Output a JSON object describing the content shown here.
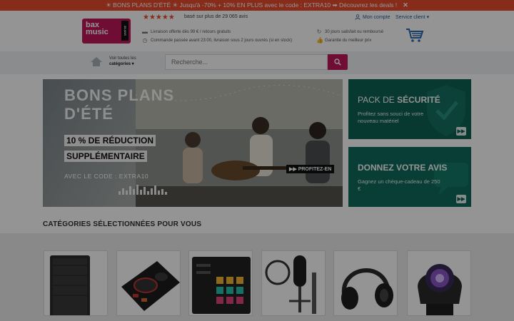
{
  "promo_banner": {
    "text": "☀ BONS PLANS D'ÉTÉ ☀ Jusqu'à -70% + 10% EN PLUS avec le code : EXTRA10 ➡ Découvrez les deals !",
    "close_symbol": "✕"
  },
  "logo": {
    "line1": "bax",
    "line2": "music",
    "badge": "25 ANS"
  },
  "rating": {
    "stars": "★★★★★",
    "text": "basé sur plus de 29 065 avis"
  },
  "account": {
    "label": "Mon compte",
    "icon": "user-icon"
  },
  "customer_service": {
    "label": "Service client ▾"
  },
  "usps": {
    "delivery": "Livraison offerte dès 99 € / retours gratuits",
    "order_time": "Commande passée avant 23:00, livraison sous 2 jours ouvrés (si en stock)",
    "satisfaction": "30 jours satisfait ou remboursé",
    "best_price": "Garantie du meilleur prix"
  },
  "nav": {
    "categories_line1": "Voir toutes les",
    "categories_line2": "catégories ▾"
  },
  "search": {
    "placeholder": "Recherche..."
  },
  "hero": {
    "title_line1": "BONS PLANS",
    "title_line2": "D'ÉTÉ",
    "badge_line1": "10 % DE RÉDUCTION",
    "badge_line2": "SUPPLÉMENTAIRE",
    "code_text": "AVEC LE CODE : EXTRA10",
    "cta": "▶▶ PROFITEZ-EN"
  },
  "cards": [
    {
      "title_light": "PACK DE ",
      "title_bold": "SÉCURITÉ",
      "subtitle": "Profitez sans souci de votre nouveau matériel",
      "arrow": "▶▶"
    },
    {
      "title_light": "",
      "title_bold": "DONNEZ VOTRE AVIS",
      "subtitle": "Gagnez un chèque-cadeau de 250 €",
      "arrow": "▶▶"
    }
  ],
  "categories": {
    "heading": "CATÉGORIES SÉLECTIONNÉES POUR VOUS",
    "tiles": [
      {
        "icon": "speaker-icon"
      },
      {
        "icon": "dj-controller-icon"
      },
      {
        "icon": "pad-controller-icon"
      },
      {
        "icon": "microphone-icon"
      },
      {
        "icon": "headphones-icon"
      },
      {
        "icon": "moving-head-light-icon"
      }
    ]
  },
  "colors": {
    "brand": "#c2185b",
    "promo": "#e84c2f",
    "card_green": "#0f6254"
  }
}
